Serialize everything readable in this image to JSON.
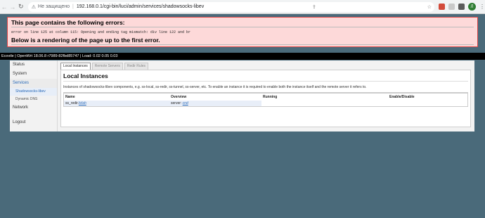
{
  "browser": {
    "security_label": "Не защищено",
    "url": "192.168.0.1/cgi-bin/luci/admin/services/shadowsocks-libev",
    "profile_initial": "Л"
  },
  "error": {
    "title": "This page contains the following errors:",
    "message": "error on line 125 at column 115: Opening and ending tag mismatch: div line 122 and br",
    "footer": "Below is a rendering of the page up to the first error."
  },
  "header": {
    "text": "Ecovile | OpenWrt 18.06.8 r7989-82fbd85747 | Load: 0.02 0.05 0.03"
  },
  "sidebar": {
    "items": [
      "Status",
      "System",
      "Services",
      "Network",
      "Logout"
    ],
    "services_sub": [
      "Shadowsocks-libev",
      "Dynamic DNS"
    ]
  },
  "tabs": [
    "Local Instances",
    "Remote Servers",
    "Redir Rules"
  ],
  "main": {
    "title": "Local Instances",
    "description": "Instances of shadowsocks-libev components, e.g. ss-local, ss-redir, ss-tunnel, ss-server, etc. To enable an instance it is required to enable both the instance itself and the remote server it refers to.",
    "columns": [
      "Name",
      "Overview",
      "Running",
      "Enable/Disable"
    ],
    "rows": [
      {
        "name": "ss_redir.",
        "name_link": "hi/ah",
        "overview_label": "server:",
        "overview_link": "cnd",
        "running": "",
        "enable": ""
      }
    ]
  }
}
